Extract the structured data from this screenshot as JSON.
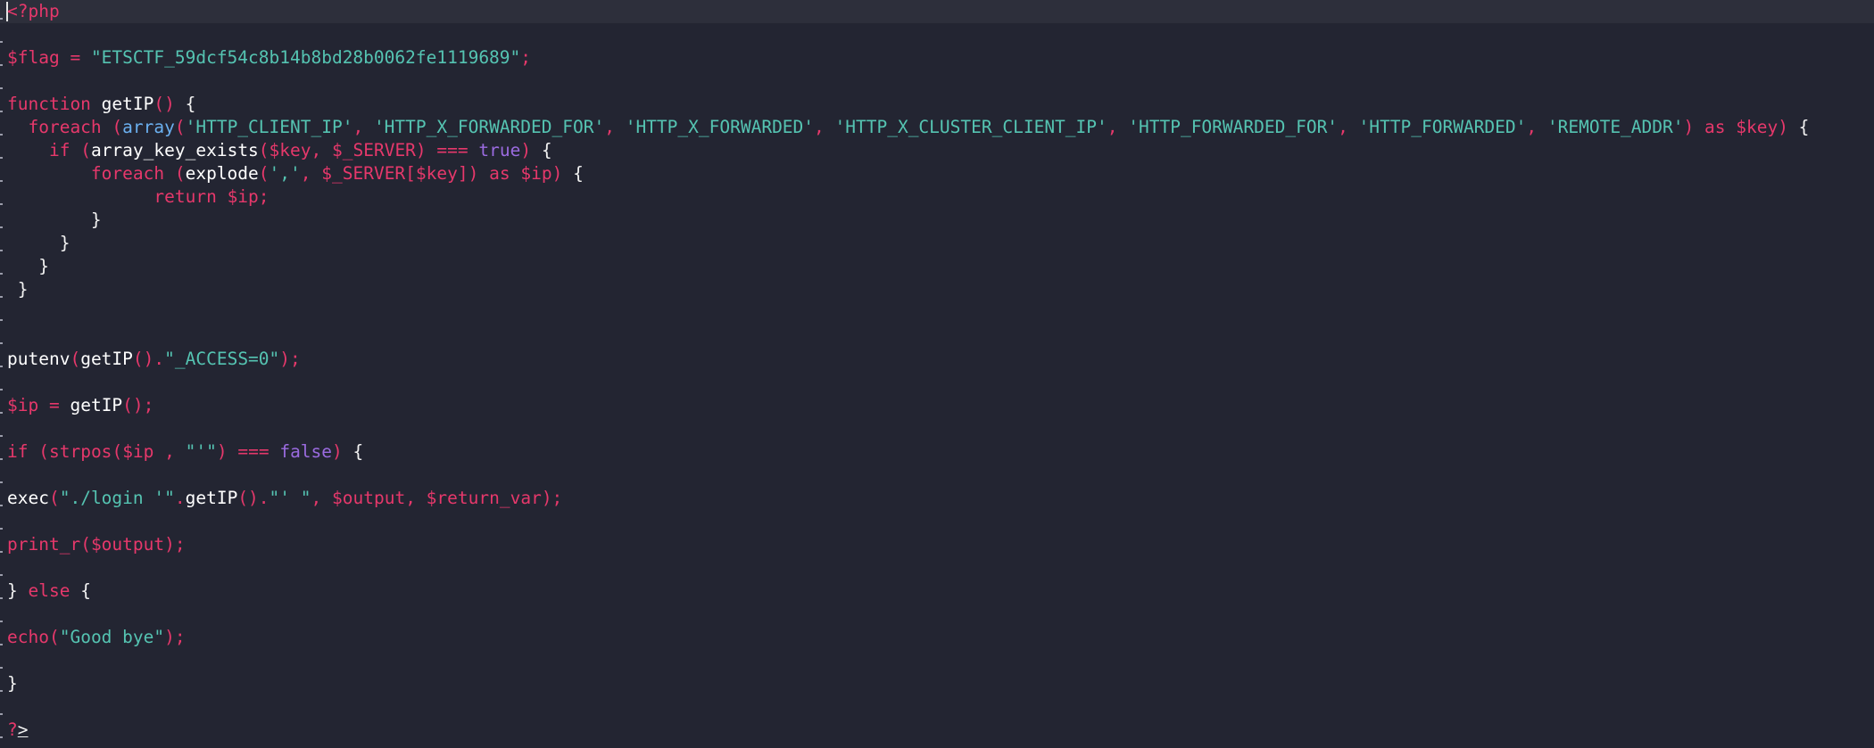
{
  "editor": {
    "theme": {
      "background": "#232532",
      "current_line": "#2d2f3b",
      "keyword": "#e6386b",
      "string": "#55c4b2",
      "boolean": "#9b6be0",
      "builtin": "#6bb0f0",
      "plain": "#f2f2f2"
    },
    "lines": [
      [
        [
          "tag",
          "<?php"
        ]
      ],
      [],
      [
        [
          "var",
          "$flag"
        ],
        [
          "op",
          " = "
        ],
        [
          "str",
          "\"ETSCTF_59dcf54c8b14b8bd28b0062fe1119689\""
        ],
        [
          "op",
          ";"
        ]
      ],
      [],
      [
        [
          "kw",
          "function "
        ],
        [
          "fn",
          "getIP"
        ],
        [
          "op",
          "() "
        ],
        [
          "pl",
          "{"
        ]
      ],
      [
        [
          "pl",
          "  "
        ],
        [
          "kw",
          "foreach "
        ],
        [
          "op",
          "("
        ],
        [
          "arr",
          "array"
        ],
        [
          "op",
          "("
        ],
        [
          "str",
          "'HTTP_CLIENT_IP'"
        ],
        [
          "op",
          ", "
        ],
        [
          "str",
          "'HTTP_X_FORWARDED_FOR'"
        ],
        [
          "op",
          ", "
        ],
        [
          "str",
          "'HTTP_X_FORWARDED'"
        ],
        [
          "op",
          ", "
        ],
        [
          "str",
          "'HTTP_X_CLUSTER_CLIENT_IP'"
        ],
        [
          "op",
          ", "
        ],
        [
          "str",
          "'HTTP_FORWARDED_FOR'"
        ],
        [
          "op",
          ", "
        ],
        [
          "str",
          "'HTTP_FORWARDED'"
        ],
        [
          "op",
          ", "
        ],
        [
          "str",
          "'REMOTE_ADDR'"
        ],
        [
          "op",
          ") "
        ],
        [
          "kw",
          "as "
        ],
        [
          "var",
          "$key"
        ],
        [
          "op",
          ") "
        ],
        [
          "pl",
          "{"
        ]
      ],
      [
        [
          "pl",
          "    "
        ],
        [
          "kw",
          "if "
        ],
        [
          "op",
          "("
        ],
        [
          "fn",
          "array_key_exists"
        ],
        [
          "op",
          "("
        ],
        [
          "var",
          "$key"
        ],
        [
          "op",
          ", "
        ],
        [
          "var",
          "$_SERVER"
        ],
        [
          "op",
          ") === "
        ],
        [
          "bool",
          "true"
        ],
        [
          "op",
          ") "
        ],
        [
          "pl",
          "{"
        ]
      ],
      [
        [
          "pl",
          "        "
        ],
        [
          "kw",
          "foreach "
        ],
        [
          "op",
          "("
        ],
        [
          "fn",
          "explode"
        ],
        [
          "op",
          "("
        ],
        [
          "str",
          "','"
        ],
        [
          "op",
          ", "
        ],
        [
          "var",
          "$_SERVER"
        ],
        [
          "op",
          "["
        ],
        [
          "var",
          "$key"
        ],
        [
          "op",
          "]) "
        ],
        [
          "kw",
          "as "
        ],
        [
          "var",
          "$ip"
        ],
        [
          "op",
          ") "
        ],
        [
          "pl",
          "{"
        ]
      ],
      [
        [
          "pl",
          "              "
        ],
        [
          "kw",
          "return "
        ],
        [
          "var",
          "$ip"
        ],
        [
          "op",
          ";"
        ]
      ],
      [
        [
          "pl",
          "        }"
        ]
      ],
      [
        [
          "pl",
          "     }"
        ]
      ],
      [
        [
          "pl",
          "   }"
        ]
      ],
      [
        [
          "pl",
          " }"
        ]
      ],
      [],
      [],
      [
        [
          "fn",
          "putenv"
        ],
        [
          "op",
          "("
        ],
        [
          "fn",
          "getIP"
        ],
        [
          "op",
          "()."
        ],
        [
          "str",
          "\"_ACCESS=0\""
        ],
        [
          "op",
          ");"
        ]
      ],
      [],
      [
        [
          "var",
          "$ip"
        ],
        [
          "op",
          " = "
        ],
        [
          "fn",
          "getIP"
        ],
        [
          "op",
          "();"
        ]
      ],
      [],
      [
        [
          "kw",
          "if "
        ],
        [
          "op",
          "("
        ],
        [
          "kw",
          "strpos"
        ],
        [
          "op",
          "("
        ],
        [
          "var",
          "$ip "
        ],
        [
          "op",
          ", "
        ],
        [
          "str",
          "\"'\""
        ],
        [
          "op",
          ") === "
        ],
        [
          "bool",
          "false"
        ],
        [
          "op",
          ") "
        ],
        [
          "pl",
          "{"
        ]
      ],
      [],
      [
        [
          "fn",
          "exec"
        ],
        [
          "op",
          "("
        ],
        [
          "str",
          "\"./login '\""
        ],
        [
          "op",
          "."
        ],
        [
          "fn",
          "getIP"
        ],
        [
          "op",
          "()."
        ],
        [
          "str",
          "\"' \""
        ],
        [
          "op",
          ", "
        ],
        [
          "var",
          "$output"
        ],
        [
          "op",
          ", "
        ],
        [
          "var",
          "$return_var"
        ],
        [
          "op",
          ");"
        ]
      ],
      [],
      [
        [
          "kw",
          "print_r"
        ],
        [
          "op",
          "("
        ],
        [
          "var",
          "$output"
        ],
        [
          "op",
          ");"
        ]
      ],
      [],
      [
        [
          "pl",
          "} "
        ],
        [
          "kw",
          "else "
        ],
        [
          "pl",
          "{"
        ]
      ],
      [],
      [
        [
          "kw",
          "echo"
        ],
        [
          "op",
          "("
        ],
        [
          "str",
          "\"Good bye\""
        ],
        [
          "op",
          ");"
        ]
      ],
      [],
      [
        [
          "pl",
          "}"
        ]
      ],
      [],
      [
        [
          "tag",
          "?>"
        ]
      ]
    ]
  }
}
